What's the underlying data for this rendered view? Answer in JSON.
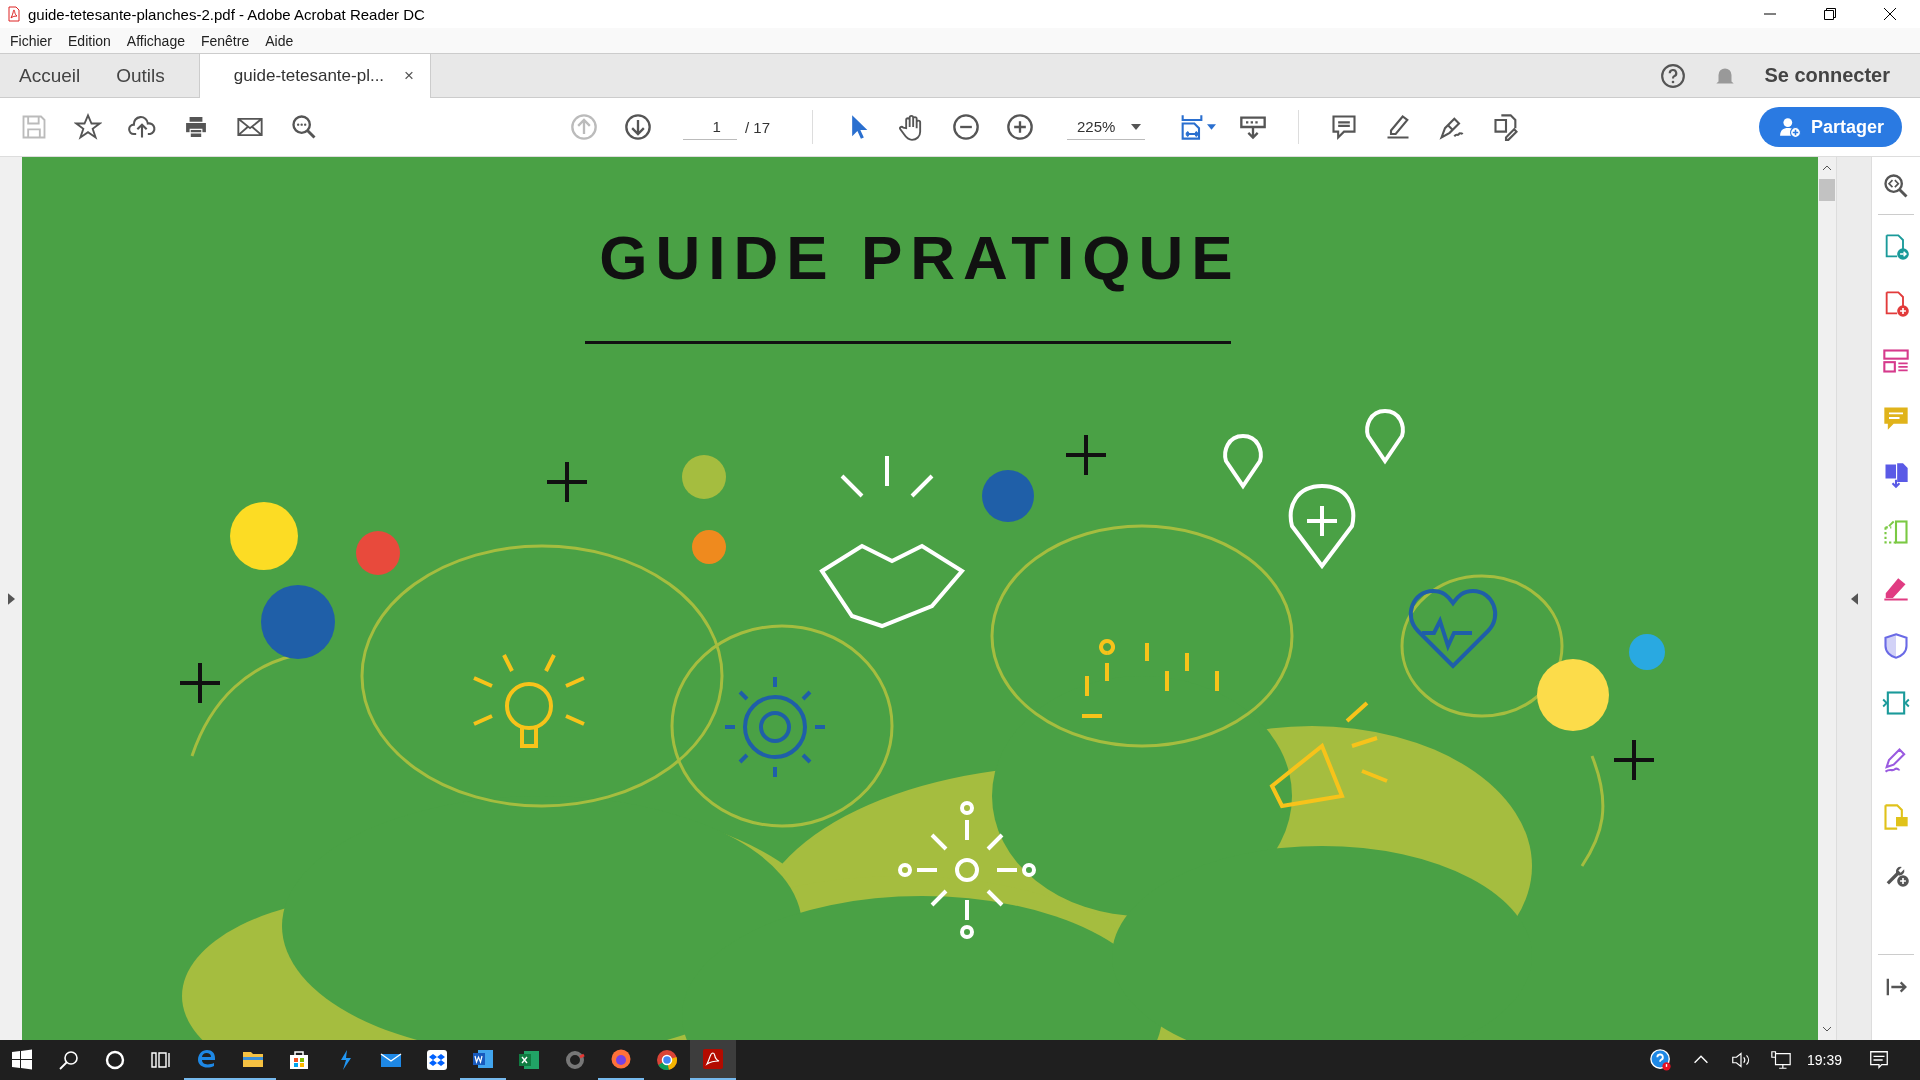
{
  "window": {
    "title": "guide-tetesante-planches-2.pdf - Adobe Acrobat Reader DC"
  },
  "menu": [
    "Fichier",
    "Edition",
    "Affichage",
    "Fenêtre",
    "Aide"
  ],
  "tabs": [
    {
      "label": "Accueil",
      "selected": false
    },
    {
      "label": "Outils",
      "selected": false
    },
    {
      "label": "guide-tetesante-pl...",
      "selected": true,
      "close": "×"
    }
  ],
  "account": {
    "sign_in": "Se connecter"
  },
  "toolbar": {
    "left_tools": [
      {
        "kind": "save",
        "disabled": true
      },
      {
        "kind": "star",
        "disabled": false
      },
      {
        "kind": "upload",
        "disabled": false
      },
      {
        "kind": "print",
        "disabled": false
      },
      {
        "kind": "mail",
        "disabled": false
      },
      {
        "kind": "find",
        "disabled": false
      }
    ],
    "nav": [
      {
        "kind": "up",
        "disabled": true
      },
      {
        "kind": "down",
        "disabled": false
      }
    ],
    "page": "1",
    "page_total": "/ 17",
    "modes": [
      {
        "kind": "pointer",
        "selected": true
      },
      {
        "kind": "hand",
        "selected": false
      },
      {
        "kind": "zoom-out",
        "selected": false
      },
      {
        "kind": "zoom-in",
        "selected": false
      }
    ],
    "zoom": "225%",
    "right_tools": [
      {
        "kind": "fit"
      },
      {
        "kind": "scroll"
      },
      {
        "kind": "comment"
      },
      {
        "kind": "highlight"
      },
      {
        "kind": "sign"
      },
      {
        "kind": "edit"
      }
    ],
    "share": "Partager"
  },
  "document": {
    "title": "GUIDE PRATIQUE"
  },
  "tools_pane": [
    {
      "kind": "export",
      "color": "#1a9a9a"
    },
    {
      "kind": "create",
      "color": "#e23b3b"
    },
    {
      "kind": "organize",
      "color": "#d63a8c"
    },
    {
      "kind": "comment",
      "color": "#e0b31a"
    },
    {
      "kind": "combine",
      "color": "#5a5ae6"
    },
    {
      "kind": "crop",
      "color": "#7ac943"
    },
    {
      "kind": "redact",
      "color": "#e03c82"
    },
    {
      "kind": "protect",
      "color": "#6a6ae6"
    },
    {
      "kind": "compress",
      "color": "#1a9a9a"
    },
    {
      "kind": "fill-sign",
      "color": "#9a5ae0"
    },
    {
      "kind": "send-comments",
      "color": "#e0c21a"
    },
    {
      "kind": "more-tools",
      "color": "#555555"
    }
  ],
  "taskbar": {
    "apps": [
      {
        "kind": "search",
        "running": false,
        "selected": false
      },
      {
        "kind": "cortana",
        "running": false,
        "selected": false
      },
      {
        "kind": "taskview",
        "running": false,
        "selected": false
      },
      {
        "kind": "edge",
        "running": true,
        "selected": false
      },
      {
        "kind": "explorer",
        "running": true,
        "selected": false
      },
      {
        "kind": "store",
        "running": false,
        "selected": false
      },
      {
        "kind": "app",
        "running": false,
        "selected": false
      },
      {
        "kind": "mail",
        "running": false,
        "selected": false
      },
      {
        "kind": "dropbox",
        "running": false,
        "selected": false
      },
      {
        "kind": "word",
        "running": true,
        "selected": false
      },
      {
        "kind": "excel",
        "running": false,
        "selected": false
      },
      {
        "kind": "recorder",
        "running": false,
        "selected": false
      },
      {
        "kind": "firefox",
        "running": true,
        "selected": false
      },
      {
        "kind": "chrome",
        "running": false,
        "selected": false
      },
      {
        "kind": "acrobat",
        "running": true,
        "selected": true
      }
    ],
    "time": "19:39"
  }
}
